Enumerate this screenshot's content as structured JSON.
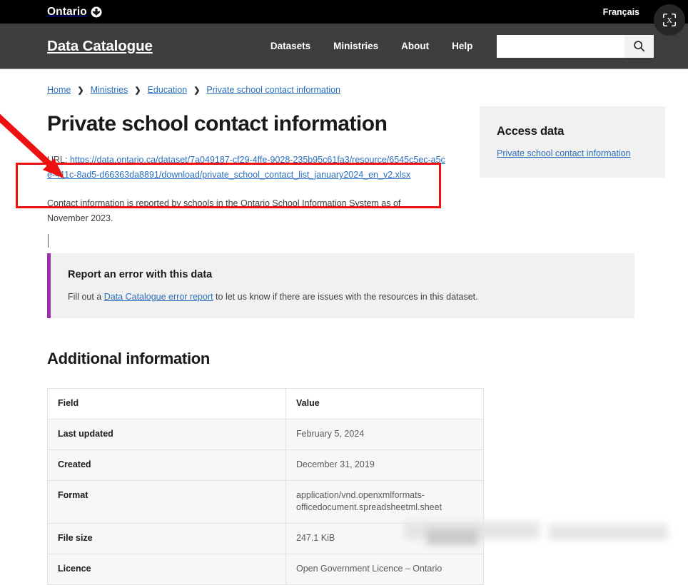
{
  "ontario_bar": {
    "wordmark": "Ontario",
    "logo_icon": "trillium-icon",
    "language_link": "Français"
  },
  "capture_badge": {
    "icon": "translate-capture-icon"
  },
  "site_header": {
    "title": "Data Catalogue",
    "nav": [
      {
        "label": "Datasets"
      },
      {
        "label": "Ministries"
      },
      {
        "label": "About"
      },
      {
        "label": "Help"
      }
    ],
    "search": {
      "value": "",
      "placeholder": "",
      "button_icon": "search-icon"
    }
  },
  "breadcrumb": {
    "separator": "❯",
    "items": [
      {
        "label": "Home"
      },
      {
        "label": "Ministries"
      },
      {
        "label": "Education"
      },
      {
        "label": "Private school contact information"
      }
    ]
  },
  "main": {
    "page_title": "Private school contact information",
    "url_label": "URL:",
    "url_value": "https://data.ontario.ca/dataset/7a049187-cf29-4ffe-9028-235b95c61fa3/resource/6545c5ec-a5ce-411c-8ad5-d66363da8891/download/private_school_contact_list_january2024_en_v2.xlsx",
    "description": "Contact information is reported by schools in the Ontario School Information System as of November 2023.",
    "error_callout": {
      "heading": "Report an error with this data",
      "text_before": "Fill out a ",
      "link": "Data Catalogue error report",
      "text_after": " to let us know if there are issues with the resources in this dataset.",
      "accent_color": "#9B30AF"
    }
  },
  "sidebar": {
    "access_data": {
      "heading": "Access data",
      "link": "Private school contact information"
    }
  },
  "additional_information": {
    "section_title": "Additional information",
    "columns": [
      "Field",
      "Value"
    ],
    "rows": [
      {
        "field": "Last updated",
        "value": "February 5, 2024"
      },
      {
        "field": "Created",
        "value": "December 31, 2019"
      },
      {
        "field": "Format",
        "value": "application/vnd.openxmlformats-officedocument.spreadsheetml.sheet"
      },
      {
        "field": "File size",
        "value": "247.1 KiB"
      },
      {
        "field": "Licence",
        "value": "Open Government Licence – Ontario"
      }
    ]
  },
  "annotations": {
    "highlight_color": "#ee1111",
    "arrow_target": "url-value-link",
    "rect_target": "url-line"
  },
  "colors": {
    "ontario_bar_bg": "#000000",
    "header_bg": "#3d3d3d",
    "link_blue": "#2a6ebb",
    "callout_bg": "#f1f1f1",
    "table_row_bg": "#f7f7f7"
  }
}
